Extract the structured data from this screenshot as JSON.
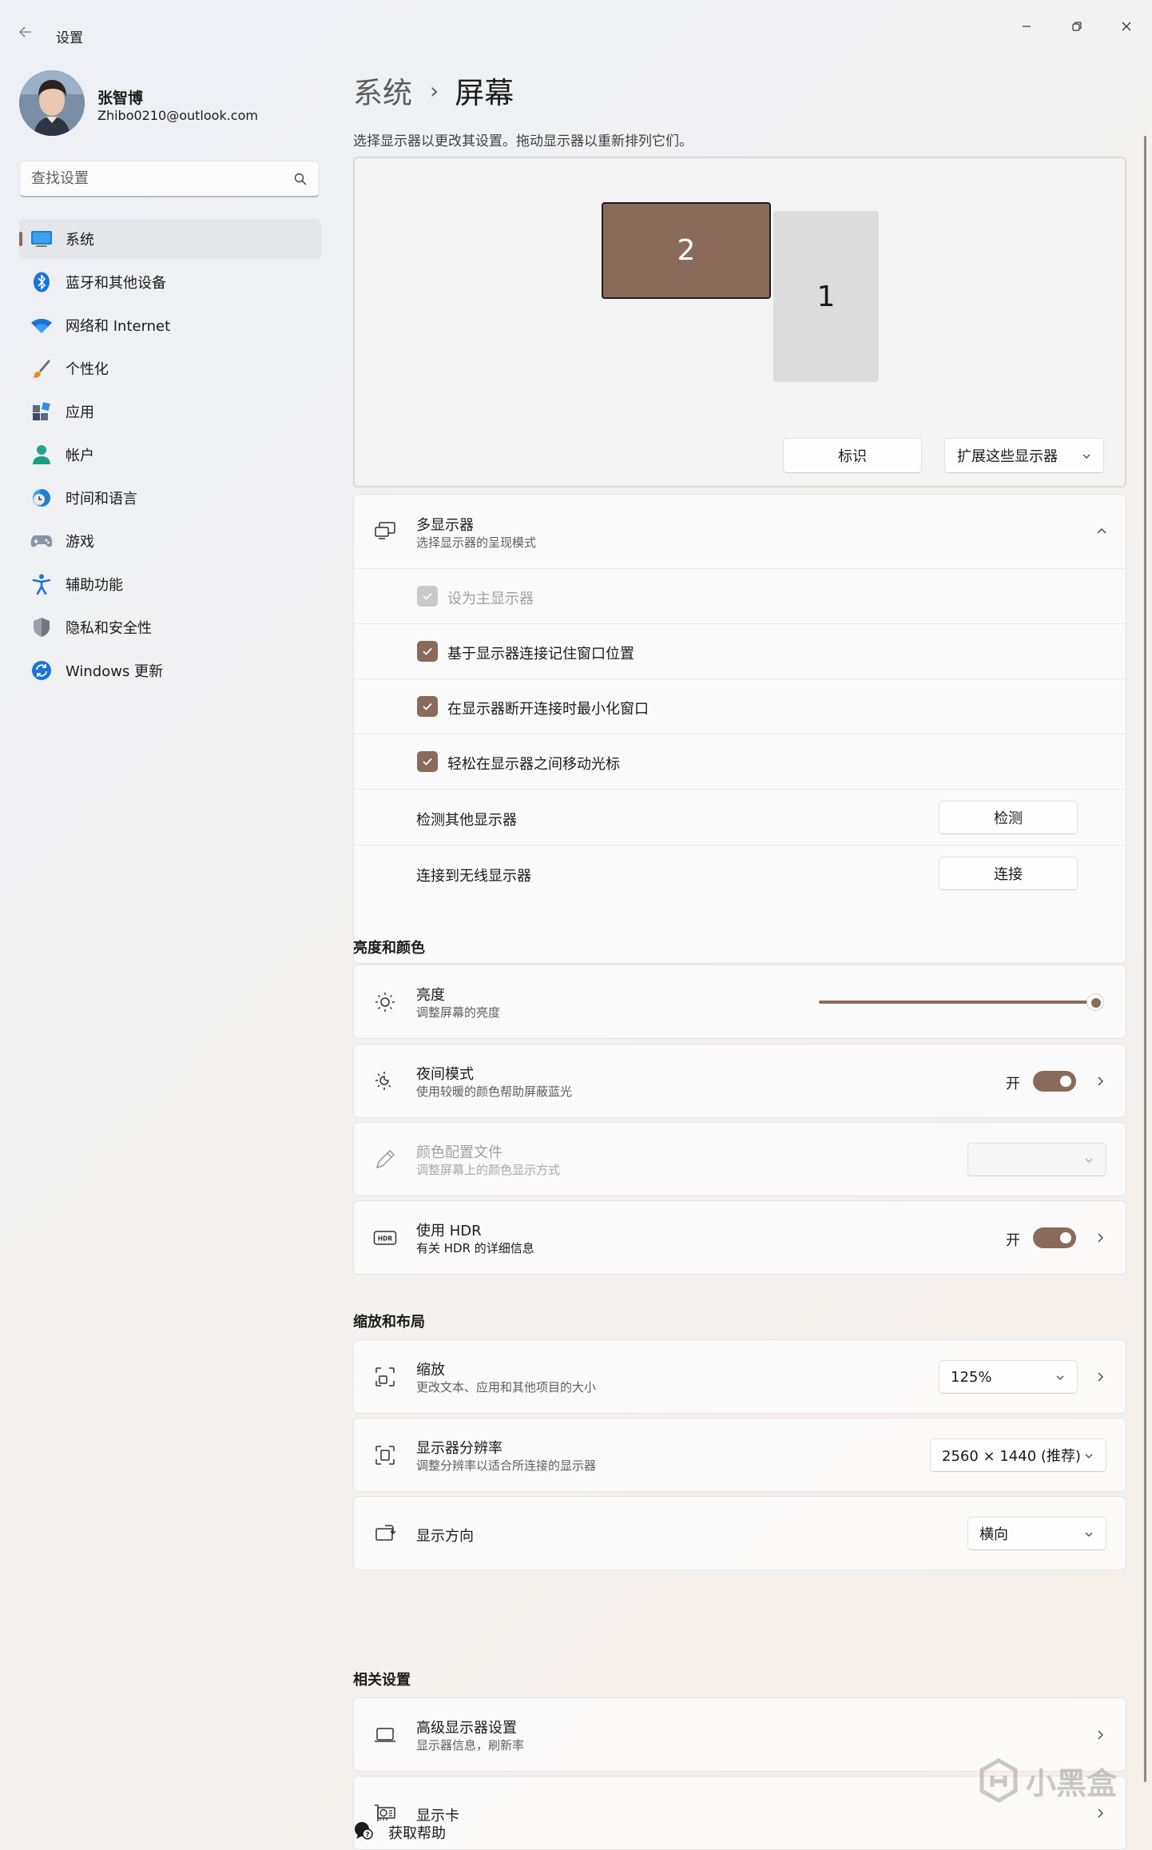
{
  "window": {
    "title": "设置"
  },
  "profile": {
    "name": "张智博",
    "email": "Zhibo0210@outlook.com"
  },
  "search": {
    "placeholder": "查找设置"
  },
  "sidebar": {
    "items": [
      {
        "label": "系统",
        "icon": "system-icon",
        "active": true
      },
      {
        "label": "蓝牙和其他设备",
        "icon": "bluetooth-icon"
      },
      {
        "label": "网络和 Internet",
        "icon": "wifi-icon"
      },
      {
        "label": "个性化",
        "icon": "brush-icon"
      },
      {
        "label": "应用",
        "icon": "apps-icon"
      },
      {
        "label": "帐户",
        "icon": "account-icon"
      },
      {
        "label": "时间和语言",
        "icon": "clock-globe-icon"
      },
      {
        "label": "游戏",
        "icon": "gamepad-icon"
      },
      {
        "label": "辅助功能",
        "icon": "accessibility-icon"
      },
      {
        "label": "隐私和安全性",
        "icon": "shield-icon"
      },
      {
        "label": "Windows 更新",
        "icon": "update-icon"
      }
    ]
  },
  "breadcrumb": {
    "parent": "系统",
    "separator": "›",
    "current": "屏幕"
  },
  "arrange": {
    "subtitle": "选择显示器以更改其设置。拖动显示器以重新排列它们。",
    "monitors": [
      "2",
      "1"
    ],
    "identify_label": "标识",
    "extend_label": "扩展这些显示器"
  },
  "multi_display": {
    "title": "多显示器",
    "desc": "选择显示器的呈现模式",
    "options": [
      {
        "label": "设为主显示器",
        "checked": true,
        "disabled": true
      },
      {
        "label": "基于显示器连接记住窗口位置",
        "checked": true
      },
      {
        "label": "在显示器断开连接时最小化窗口",
        "checked": true
      },
      {
        "label": "轻松在显示器之间移动光标",
        "checked": true
      }
    ],
    "detect": {
      "label": "检测其他显示器",
      "button": "检测"
    },
    "wireless": {
      "label": "连接到无线显示器",
      "button": "连接"
    }
  },
  "brightness_color": {
    "section_title": "亮度和颜色",
    "brightness": {
      "title": "亮度",
      "desc": "调整屏幕的亮度",
      "value_percent": 100
    },
    "night_light": {
      "title": "夜间模式",
      "desc": "使用较暖的颜色帮助屏蔽蓝光",
      "state": "开"
    },
    "color_profile": {
      "title": "颜色配置文件",
      "desc": "调整屏幕上的颜色显示方式",
      "value": ""
    },
    "hdr": {
      "title": "使用 HDR",
      "desc": "有关 HDR 的详细信息",
      "state": "开"
    }
  },
  "scale_layout": {
    "section_title": "缩放和布局",
    "scale": {
      "title": "缩放",
      "desc": "更改文本、应用和其他项目的大小",
      "value": "125%"
    },
    "resolution": {
      "title": "显示器分辨率",
      "desc": "调整分辨率以适合所连接的显示器",
      "value": "2560 × 1440 (推荐)"
    },
    "orientation": {
      "title": "显示方向",
      "value": "横向"
    }
  },
  "related": {
    "section_title": "相关设置",
    "advanced": {
      "title": "高级显示器设置",
      "desc": "显示器信息，刷新率"
    },
    "gpu": {
      "title": "显示卡"
    }
  },
  "help": {
    "label": "获取帮助"
  },
  "watermark": {
    "text": "小黑盒"
  },
  "colors": {
    "accent": "#8a6a5a",
    "background": "#f3f2f1"
  }
}
